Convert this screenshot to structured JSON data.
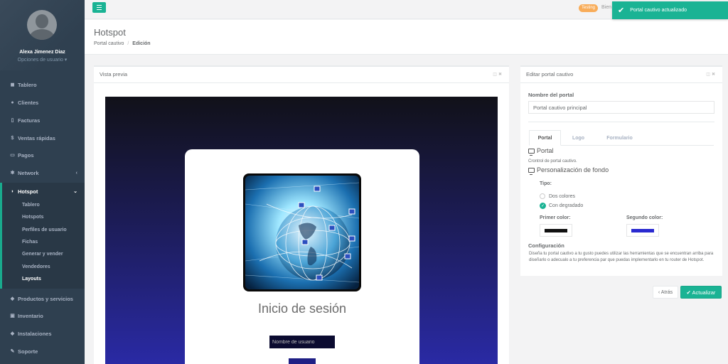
{
  "user": {
    "name": "Alexa Jimenez Diaz",
    "options_label": "Opciones de usuario ▾"
  },
  "sidebar": {
    "items": [
      {
        "label": "Tablero",
        "icon": "dashboard-icon",
        "glyph": "◼"
      },
      {
        "label": "Clientes",
        "icon": "users-icon",
        "glyph": "●"
      },
      {
        "label": "Facturas",
        "icon": "file-icon",
        "glyph": "▯"
      },
      {
        "label": "Ventas rápidas",
        "icon": "dollar-icon",
        "glyph": "$"
      },
      {
        "label": "Pagos",
        "icon": "money-icon",
        "glyph": "▭"
      },
      {
        "label": "Network",
        "icon": "network-icon",
        "glyph": "✱",
        "chevron": "‹"
      },
      {
        "label": "Hotspot",
        "icon": "wifi-icon",
        "glyph": "◗",
        "chevron": "⌄"
      },
      {
        "label": "Productos y servicios",
        "icon": "tag-icon",
        "glyph": "◆"
      },
      {
        "label": "Inventario",
        "icon": "cubes-icon",
        "glyph": "▣"
      },
      {
        "label": "Instalaciones",
        "icon": "diamond-icon",
        "glyph": "◆"
      },
      {
        "label": "Soporte",
        "icon": "wrench-icon",
        "glyph": "✎"
      }
    ],
    "hotspot_sub": [
      "Tablero",
      "Hotspots",
      "Perfiles de usuario",
      "Fichas",
      "Generar y vender",
      "Vendedores",
      "Layouts"
    ]
  },
  "topbar": {
    "badge": "Testing",
    "welcome": "Bien"
  },
  "page": {
    "title": "Hotspot",
    "breadcrumb_1": "Portal cautivo",
    "breadcrumb_sep": "/",
    "breadcrumb_2": "Edición"
  },
  "preview": {
    "title": "Vista previa",
    "login_title": "Inicio de sesión",
    "username_placeholder": "Nombre de usuario",
    "colors": {
      "primary": "#111111",
      "secondary": "#2a2ad0"
    }
  },
  "editor": {
    "title": "Editar portal cautivo",
    "name_label": "Nombre del portal",
    "name_value": "Portal cautivo principal",
    "tabs": [
      "Portal",
      "Logo",
      "Formulario"
    ],
    "portal_heading": "Portal",
    "portal_sub": "Crontrol de portal cautivo.",
    "bg_heading": "Personalización de fondo",
    "type_label": "Tipo:",
    "option_1": "Dos colores",
    "option_2": "Con degradado",
    "primary_label": "Primer color:",
    "secondary_label": "Segundo color:",
    "config_label": "Configuración",
    "description": "Diseña tu portal cautivo a tu gusto puedes utilizar las herramientas que se encuentran arriba para diseñarlo o adecualo a tu preferencia par que puedas implementarlo en tu router de Hotspot."
  },
  "buttons": {
    "back": "‹ Atrás",
    "update": "✔ Actualizar"
  },
  "toast": {
    "message": "Portal cautivo actualizado"
  }
}
